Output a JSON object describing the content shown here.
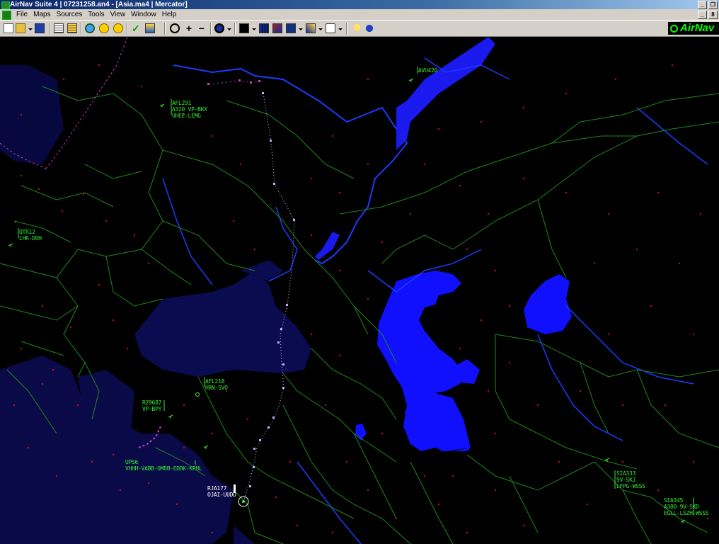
{
  "window": {
    "title": "AirNav Suite 4 | 07231258.an4 - [Asia.ma4 | Mercator]",
    "min": "_",
    "restore": "&#9633;"
  },
  "menu": {
    "items": [
      "File",
      "Maps",
      "Sources",
      "Tools",
      "View",
      "Window",
      "Help"
    ],
    "min": "_",
    "restore": "8"
  },
  "logo": {
    "text": "AirNav"
  },
  "toolbar": {
    "zoom_in": "+",
    "zoom_out": "−"
  },
  "flights": [
    {
      "lines": [
        "AFL291",
        "A320 VP-BKX",
        "UHEE-LEMG"
      ]
    },
    {
      "lines": [
        "AVU420"
      ]
    },
    {
      "lines": [
        "QTR12",
        "LHR-DOH"
      ]
    },
    {
      "lines": [
        "AFL218",
        "HRN-SVO"
      ]
    },
    {
      "lines": [
        "R29687",
        "VP-BPY"
      ]
    },
    {
      "lines": [
        "UPS6",
        "VHHH-VABB-OMDB-EDDK-KPHL"
      ]
    },
    {
      "lines": [
        "RJA177",
        "OJAI-UUDD"
      ]
    },
    {
      "lines": [
        "SIA333",
        "9V-SKJ",
        "LFPG-WSSS"
      ]
    },
    {
      "lines": [
        "SIA345",
        "A380 9V-SKD",
        "EGLL-LSZH-WSSS"
      ]
    }
  ],
  "colors": {
    "water": "#1010ff",
    "sea_land": "#0a0a4a",
    "borders": "#1d8a1d",
    "airport": "#c01010",
    "label": "#33ee33",
    "track": "#b080ff"
  }
}
